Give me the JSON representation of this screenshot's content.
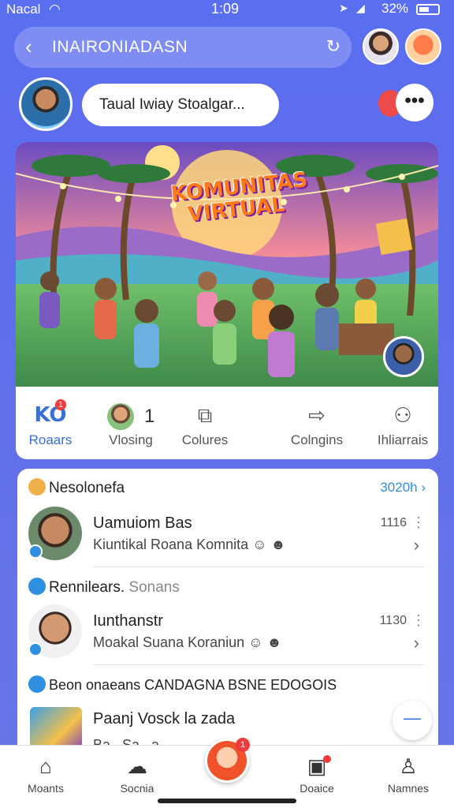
{
  "status_bar": {
    "carrier": "Nacal",
    "time": "1:09",
    "battery": "32%"
  },
  "header": {
    "back_icon": "chevron-left-icon",
    "title": "INAIRONIADASN",
    "refresh_icon": "refresh-icon"
  },
  "profile": {
    "name": "Taual Iwiay Stoalgar...",
    "more_label": "•••"
  },
  "post": {
    "banner_title": "KOMUNITAS VIRTUAL",
    "actions": [
      {
        "label": "Roaars",
        "icon": "KO",
        "badge": "1",
        "color": "#3a6fd8"
      },
      {
        "label": "Vlosing",
        "count": "1"
      },
      {
        "label": "Colures",
        "icon": "photo-icon",
        "active": true
      },
      {
        "label": "Colngins",
        "icon": "share-icon"
      },
      {
        "label": "Ihliarrais",
        "icon": "people-icon"
      }
    ]
  },
  "feed": {
    "section1": {
      "title": "Nesolonefa",
      "see_all": "3020h"
    },
    "row1": {
      "name": "Uamuiom Bas",
      "sub": "Kiuntikal Roana Komnita",
      "emoji": "☺ ☻",
      "time": "1116"
    },
    "section2": {
      "title": "Rennilears.",
      "muted": "Sonans"
    },
    "row2": {
      "name": "Iunthanstr",
      "sub": "Moakal Suana Koraniun",
      "emoji": "☺ ☻",
      "time": "1130"
    },
    "section3": {
      "title": "Beon onaeans CANDAGNA BSNE EDOGOIS"
    },
    "row3": {
      "name": "Paanj Vosck",
      "name_suffix": "la zada",
      "sub": "Ba.. Sa.. a"
    }
  },
  "bottom_nav": [
    {
      "label": "Moants",
      "icon": "home-icon"
    },
    {
      "label": "Socnia",
      "icon": "chat-icon"
    },
    {
      "label": "",
      "icon": "avatar-icon",
      "badge": "1"
    },
    {
      "label": "Doaice",
      "icon": "notes-icon"
    },
    {
      "label": "Namnes",
      "icon": "person-icon"
    }
  ],
  "colors": {
    "background": "#5a6ef0",
    "accent": "#2f8fe0",
    "badge": "#ef3b3b"
  }
}
